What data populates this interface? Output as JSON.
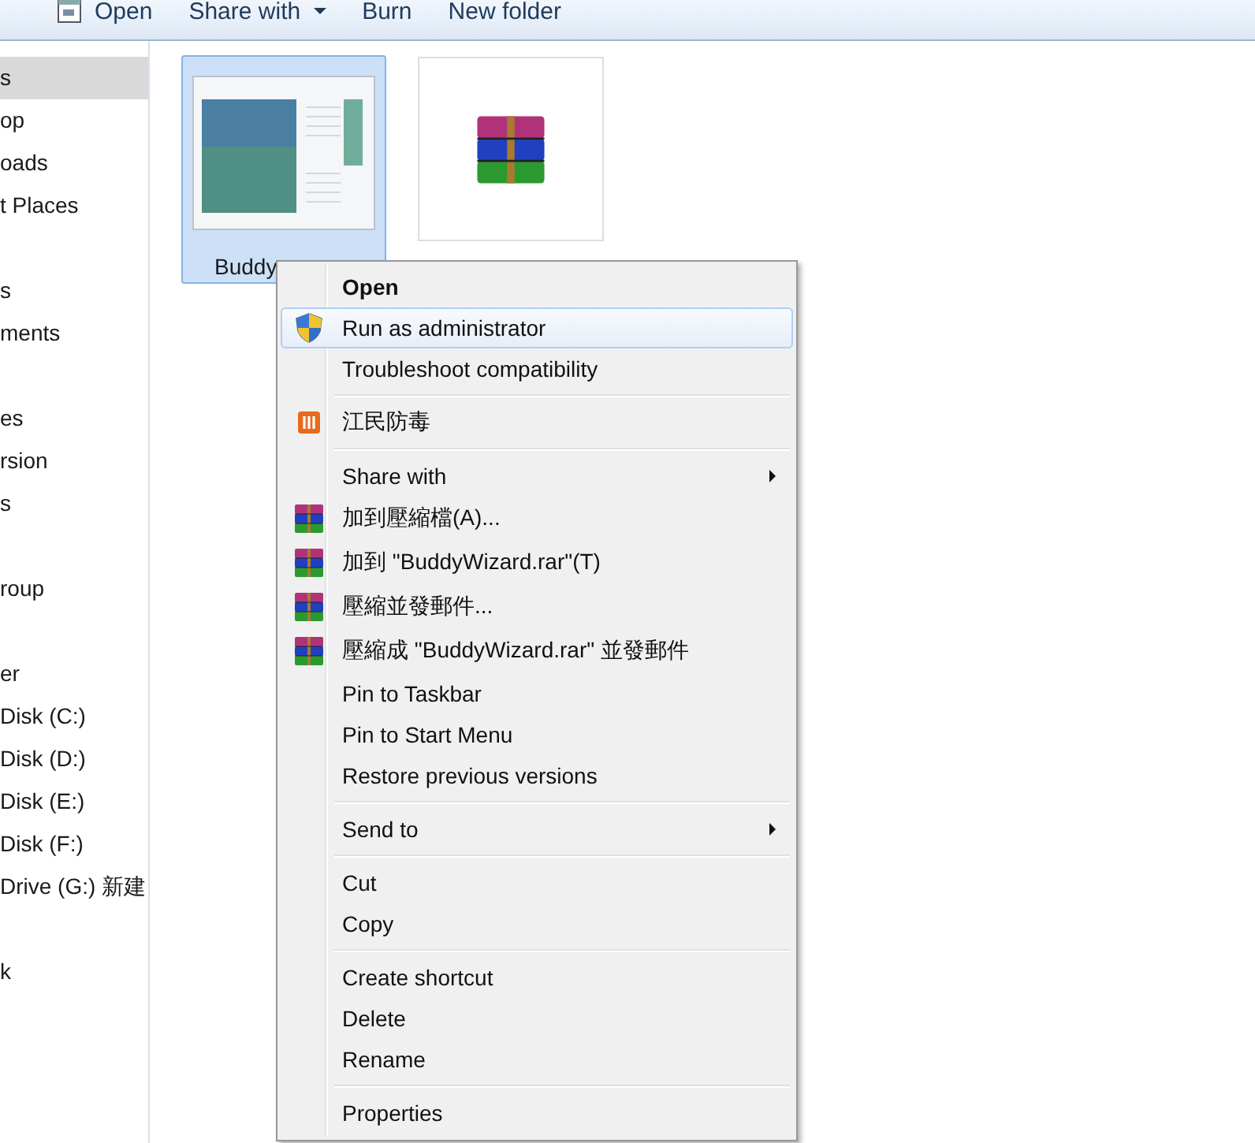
{
  "toolbar": {
    "buttons": [
      {
        "label": "Open",
        "kind": "app"
      },
      {
        "label": "Share with",
        "kind": "dropdown"
      },
      {
        "label": "Burn",
        "kind": "plain"
      },
      {
        "label": "New folder",
        "kind": "plain"
      }
    ]
  },
  "sidebar": {
    "groups": [
      {
        "items": [
          {
            "label": "s",
            "selected": true
          },
          {
            "label": "op",
            "selected": false
          },
          {
            "label": "oads",
            "selected": false
          },
          {
            "label": "t Places",
            "selected": false
          }
        ]
      },
      {
        "items": [
          {
            "label": "s",
            "selected": false
          },
          {
            "label": "ments",
            "selected": false
          }
        ]
      },
      {
        "items": [
          {
            "label": "es",
            "selected": false
          },
          {
            "label": "rsion",
            "selected": false
          },
          {
            "label": "s",
            "selected": false
          }
        ]
      },
      {
        "items": [
          {
            "label": "roup",
            "selected": false
          }
        ]
      },
      {
        "items": [
          {
            "label": "er",
            "selected": false
          },
          {
            "label": "Disk (C:)",
            "selected": false
          },
          {
            "label": "Disk (D:)",
            "selected": false
          },
          {
            "label": "Disk (E:)",
            "selected": false
          },
          {
            "label": "Disk (F:)",
            "selected": false
          },
          {
            "label": "Drive (G:) 新建",
            "selected": false
          }
        ]
      },
      {
        "items": [
          {
            "label": "k",
            "selected": false
          }
        ]
      }
    ]
  },
  "files": [
    {
      "name": "Buddy",
      "kind": "window",
      "selected": true
    },
    {
      "kind": "archive",
      "selected": false
    }
  ],
  "context_menu": {
    "items": [
      {
        "kind": "default",
        "label": "Open",
        "highlighted": false
      },
      {
        "kind": "shield",
        "label": "Run as administrator",
        "highlighted": true
      },
      {
        "kind": "plain",
        "label": "Troubleshoot compatibility",
        "highlighted": false
      },
      {
        "kind": "separator"
      },
      {
        "kind": "antivirus",
        "label": "江民防毒",
        "highlighted": false
      },
      {
        "kind": "separator"
      },
      {
        "kind": "submenu",
        "label": "Share with",
        "highlighted": false
      },
      {
        "kind": "archive",
        "label": "加到壓縮檔(A)...",
        "highlighted": false
      },
      {
        "kind": "archive",
        "label": "加到 \"BuddyWizard.rar\"(T)",
        "highlighted": false
      },
      {
        "kind": "archive",
        "label": "壓縮並發郵件...",
        "highlighted": false
      },
      {
        "kind": "archive",
        "label": "壓縮成 \"BuddyWizard.rar\" 並發郵件",
        "highlighted": false
      },
      {
        "kind": "plain",
        "label": "Pin to Taskbar",
        "highlighted": false
      },
      {
        "kind": "plain",
        "label": "Pin to Start Menu",
        "highlighted": false
      },
      {
        "kind": "plain",
        "label": "Restore previous versions",
        "highlighted": false
      },
      {
        "kind": "separator"
      },
      {
        "kind": "submenu",
        "label": "Send to",
        "highlighted": false
      },
      {
        "kind": "separator"
      },
      {
        "kind": "plain",
        "label": "Cut",
        "highlighted": false
      },
      {
        "kind": "plain",
        "label": "Copy",
        "highlighted": false
      },
      {
        "kind": "separator"
      },
      {
        "kind": "plain",
        "label": "Create shortcut",
        "highlighted": false
      },
      {
        "kind": "plain",
        "label": "Delete",
        "highlighted": false
      },
      {
        "kind": "plain",
        "label": "Rename",
        "highlighted": false
      },
      {
        "kind": "separator"
      },
      {
        "kind": "plain",
        "label": "Properties",
        "highlighted": false
      }
    ]
  }
}
